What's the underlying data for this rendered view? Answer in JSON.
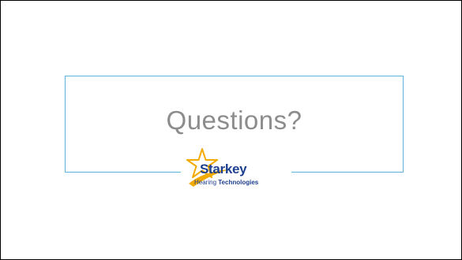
{
  "slide": {
    "title": "Questions?",
    "logo": {
      "name": "Starkey",
      "tagline_prefix": "Hearing",
      "tagline_bold": "Technologies",
      "icon": "star-swoosh-icon"
    }
  },
  "colors": {
    "frame": "#5fb4dc",
    "title_text": "#8c8c8c",
    "logo_star": "#f2a900",
    "logo_text": "#1d3f8f",
    "border": "#000000"
  }
}
